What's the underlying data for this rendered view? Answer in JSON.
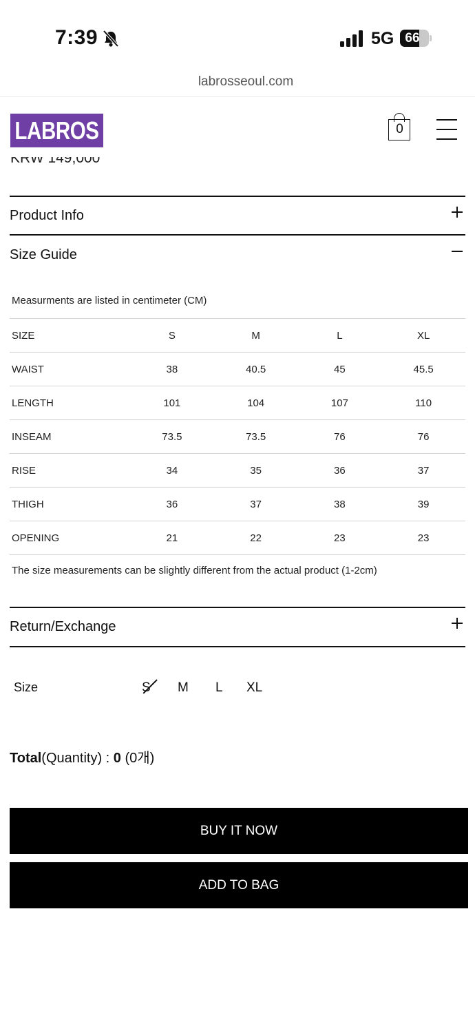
{
  "status_bar": {
    "time": "7:39",
    "network": "5G",
    "battery": "66",
    "battery_level": 0.66
  },
  "url_bar": {
    "url": "labrosseoul.com"
  },
  "header": {
    "logo_text": "LABROS",
    "logo_color": "#6f3fa6",
    "bag_count": "0",
    "price": "KRW 149,000"
  },
  "accordion": {
    "product_info": {
      "title": "Product Info",
      "state": "collapsed"
    },
    "size_guide": {
      "title": "Size Guide",
      "state": "expanded"
    },
    "return_exchange": {
      "title": "Return/Exchange",
      "state": "collapsed"
    }
  },
  "size_guide": {
    "note": "Measurments are listed in centimeter (CM)",
    "columns": [
      "SIZE",
      "S",
      "M",
      "L",
      "XL"
    ],
    "rows": [
      [
        "WAIST",
        "38",
        "40.5",
        "45",
        "45.5"
      ],
      [
        "LENGTH",
        "101",
        "104",
        "107",
        "110"
      ],
      [
        "INSEAM",
        "73.5",
        "73.5",
        "76",
        "76"
      ],
      [
        "RISE",
        "34",
        "35",
        "36",
        "37"
      ],
      [
        "THIGH",
        "36",
        "37",
        "38",
        "39"
      ],
      [
        "OPENING",
        "21",
        "22",
        "23",
        "23"
      ]
    ],
    "disclaimer": "The size measurements can be slightly different from the actual product (1-2cm)"
  },
  "size_selector": {
    "label": "Size",
    "options": [
      {
        "label": "S",
        "sold_out": true
      },
      {
        "label": "M",
        "sold_out": false
      },
      {
        "label": "L",
        "sold_out": false
      },
      {
        "label": "XL",
        "sold_out": false
      }
    ]
  },
  "total": {
    "label": "Total",
    "quantity_label": "(Quantity) : ",
    "amount": "0",
    "count": " (0개)"
  },
  "actions": {
    "buy_now": "BUY IT NOW",
    "add_to_bag": "ADD TO BAG"
  }
}
